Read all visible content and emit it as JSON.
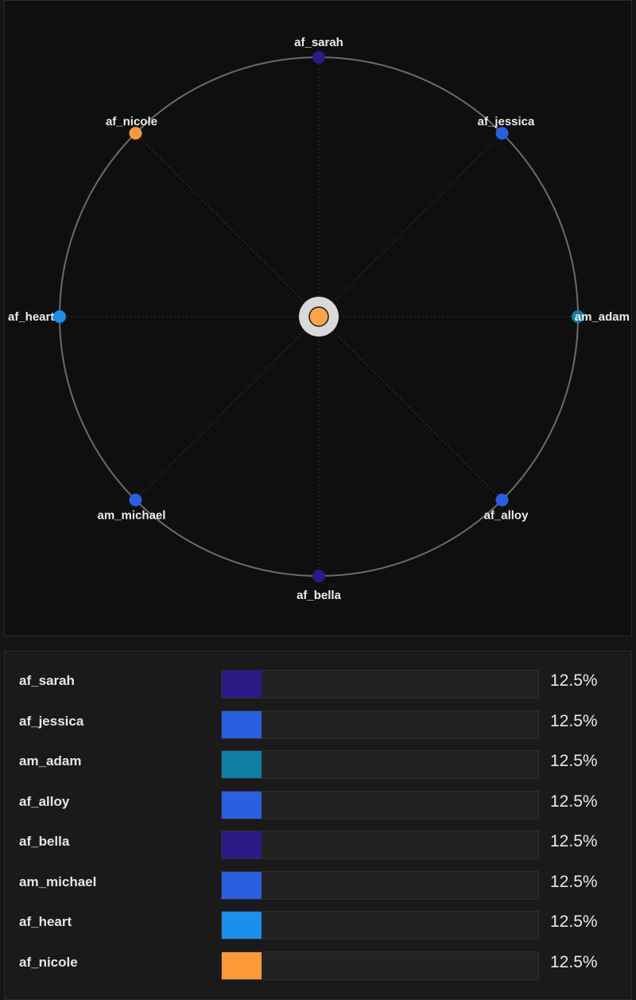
{
  "voices": [
    {
      "name": "af_sarah",
      "percent": 12.5,
      "percent_label": "12.5%",
      "color": "#2e1a87"
    },
    {
      "name": "af_jessica",
      "percent": 12.5,
      "percent_label": "12.5%",
      "color": "#2a5fe0"
    },
    {
      "name": "am_adam",
      "percent": 12.5,
      "percent_label": "12.5%",
      "color": "#0e7fa3"
    },
    {
      "name": "af_alloy",
      "percent": 12.5,
      "percent_label": "12.5%",
      "color": "#2a5fe0"
    },
    {
      "name": "af_bella",
      "percent": 12.5,
      "percent_label": "12.5%",
      "color": "#2e1a87"
    },
    {
      "name": "am_michael",
      "percent": 12.5,
      "percent_label": "12.5%",
      "color": "#2a5fe0"
    },
    {
      "name": "af_heart",
      "percent": 12.5,
      "percent_label": "12.5%",
      "color": "#1b8fea"
    },
    {
      "name": "af_nicole",
      "percent": 12.5,
      "percent_label": "12.5%",
      "color": "#fc9a3a"
    }
  ],
  "center_handle": {
    "color": "#fca34c",
    "ring_color": "#d9d9d9"
  },
  "colors": {
    "circle": "#6b6b6b",
    "spoke": "#3a3a3a",
    "background": "#0f0f0f"
  }
}
